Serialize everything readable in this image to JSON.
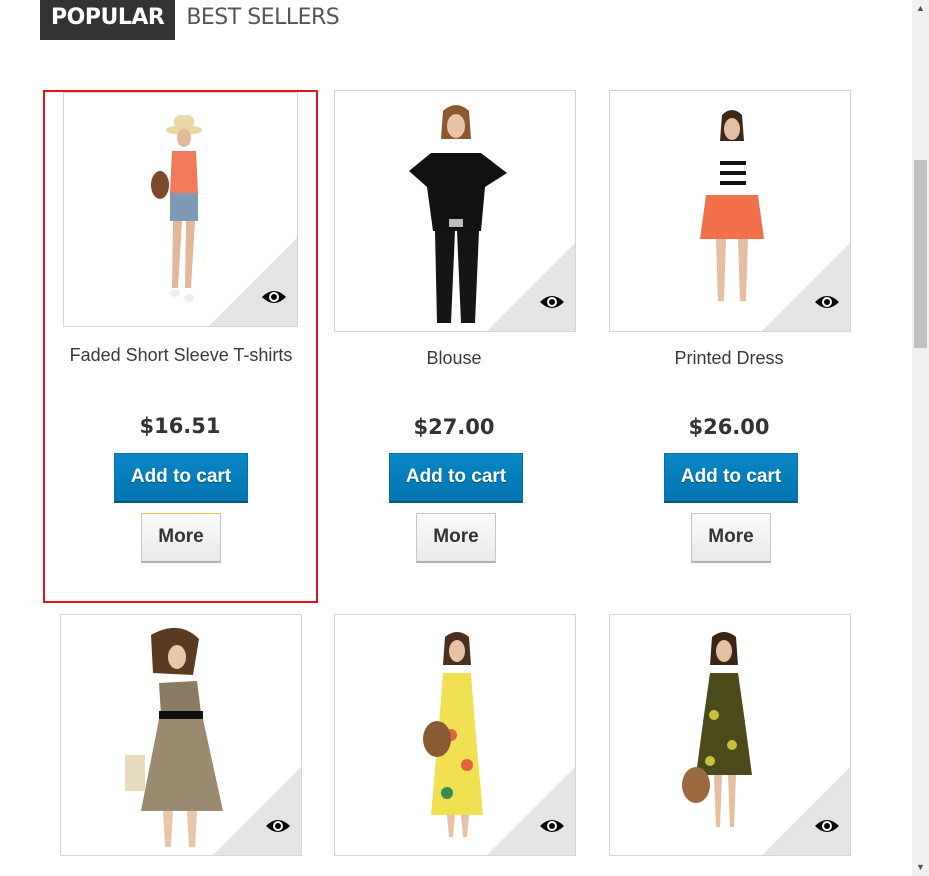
{
  "tabs": {
    "popular": "POPULAR",
    "best_sellers": "BEST SELLERS"
  },
  "products": [
    {
      "name": "Faded Short Sleeve T-shirts",
      "price": "$16.51",
      "add_to_cart": "Add to cart",
      "more": "More"
    },
    {
      "name": "Blouse",
      "price": "$27.00",
      "add_to_cart": "Add to cart",
      "more": "More"
    },
    {
      "name": "Printed Dress",
      "price": "$26.00",
      "add_to_cart": "Add to cart",
      "more": "More"
    },
    {
      "name": "",
      "price": ""
    },
    {
      "name": "",
      "price": ""
    },
    {
      "name": "",
      "price": ""
    }
  ],
  "icons": {
    "quick_view": "eye-icon",
    "scroll_up": "chevron-up-icon",
    "scroll_down": "chevron-down-icon"
  },
  "colors": {
    "accent_blue": "#0274b0",
    "tab_active": "#333333",
    "highlight": "#e0141c"
  }
}
